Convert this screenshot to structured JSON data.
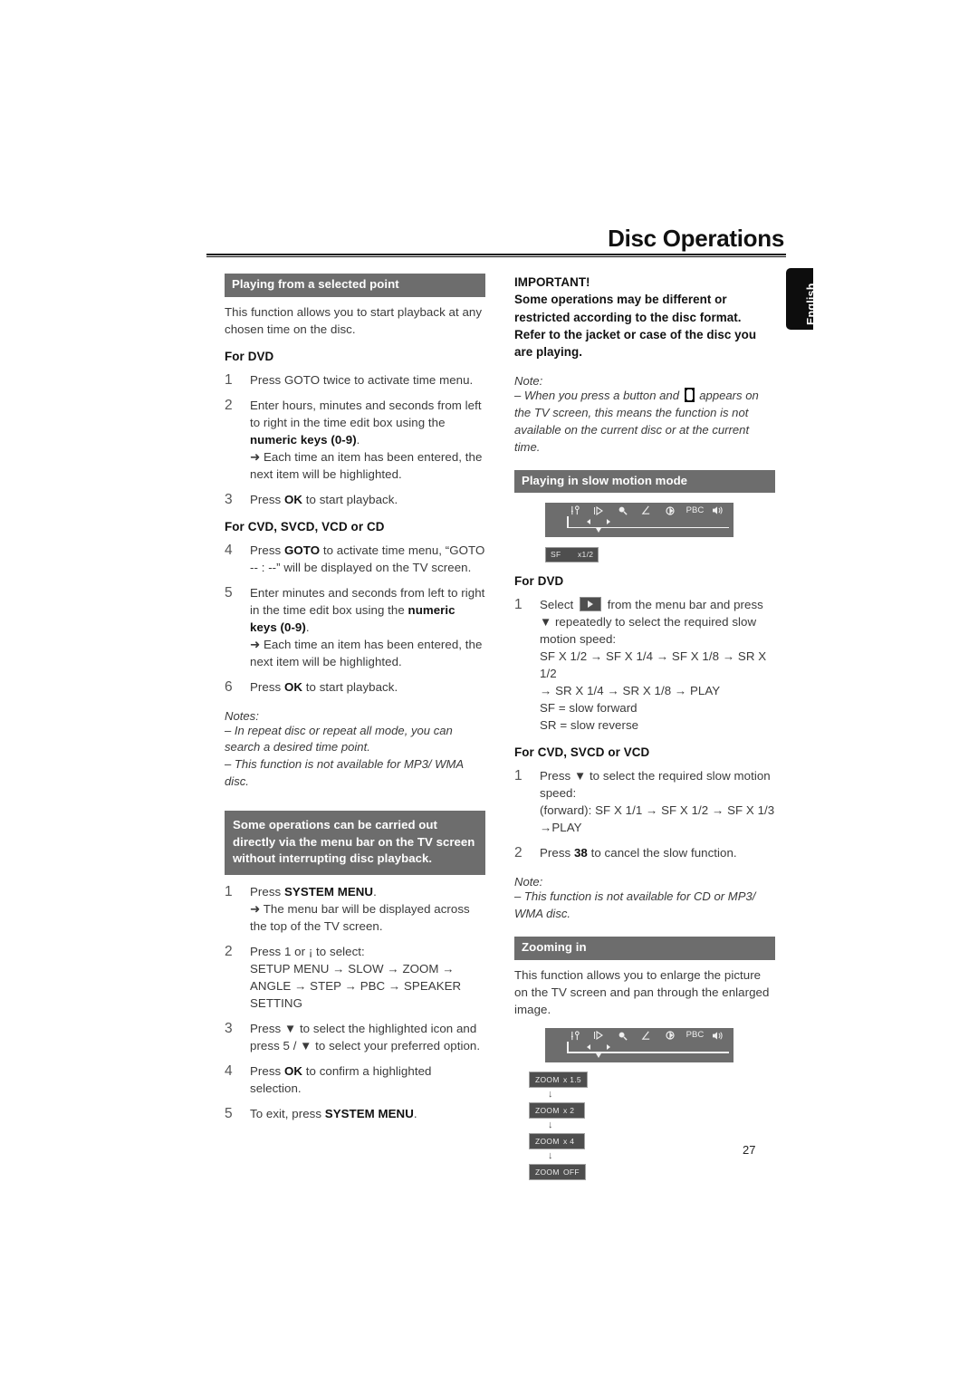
{
  "header": {
    "title": "Disc Operations",
    "language_tab": "English",
    "page_number": "27"
  },
  "left_column": {
    "section1": {
      "bar_title": "Playing from a selected point",
      "intro": "This function allows you to start playback at any chosen time on the disc.",
      "subhead_dvd": "For DVD",
      "steps_dvd": [
        {
          "num": "1",
          "text": "Press GOTO twice to activate time menu."
        },
        {
          "num": "2",
          "text_a": "Enter hours, minutes and seconds from left to right in the time edit box using the ",
          "bold": "numeric keys (0-9)",
          "text_b": ".",
          "arrow": "Each time an item has been entered, the next item will be highlighted."
        },
        {
          "num": "3",
          "text_a": "Press ",
          "bold": "OK",
          "text_b": " to start playback."
        }
      ],
      "subhead_cvd": "For CVD, SVCD, VCD or CD",
      "steps_cvd": [
        {
          "num": "4",
          "text_a": "Press ",
          "bold": "GOTO",
          "text_b": " to activate time menu, “GOTO -- : --” will be displayed on the TV screen."
        },
        {
          "num": "5",
          "text_a": "Enter minutes and seconds from left to right in the time edit box using the ",
          "bold": "numeric keys (0-9)",
          "text_b": ".",
          "arrow": "Each time an item has been entered, the next item will be highlighted."
        },
        {
          "num": "6",
          "text_a": "Press ",
          "bold": "OK",
          "text_b": " to start playback."
        }
      ],
      "notes_head": "Notes:",
      "notes": [
        "–  In repeat disc or repeat all mode, you can search a desired time point.",
        "–  This function is not available for MP3/ WMA disc."
      ]
    },
    "section2": {
      "bar_title": "Some operations can be carried out directly via the menu bar on the TV screen without interrupting disc playback.",
      "steps": [
        {
          "num": "1",
          "text_a": "Press ",
          "bold": "SYSTEM MENU",
          "text_b": ".",
          "arrow": "The menu bar will be displayed across the top of the TV screen."
        },
        {
          "num": "2",
          "text_a": "Press 1    or ¡    to select:",
          "flow": "SETUP MENU → SLOW → ZOOM → ANGLE → STEP → PBC → SPEAKER SETTING"
        },
        {
          "num": "3",
          "text_a": "Press ▼ to select the highlighted icon and press 5  / ▼ to select your preferred option."
        },
        {
          "num": "4",
          "text_a": "Press ",
          "bold": "OK",
          "text_b": " to confirm a highlighted selection."
        },
        {
          "num": "5",
          "text_a": "To exit, press ",
          "bold": "SYSTEM MENU",
          "text_b": "."
        }
      ]
    }
  },
  "right_column": {
    "important": {
      "head": "IMPORTANT!",
      "body": "Some operations may be different or restricted according to the disc format. Refer to the jacket or case of the disc you are playing."
    },
    "note1": {
      "head": "Note:",
      "text_a": "–  When you press a button and ",
      "text_b": " appears on the TV screen, this means the function is not available on the current disc or at the current time."
    },
    "slow_section": {
      "bar_title": "Playing in slow motion mode",
      "osd_chip": {
        "label": "SF",
        "value": "x1/2"
      },
      "menubar_icons": [
        "tools-icon",
        "slow-play-icon",
        "zoom-magnifier-icon",
        "angle-icon",
        "step-icon",
        "pbc-icon",
        "speaker-icon"
      ],
      "subhead_dvd": "For DVD",
      "dvd_step": {
        "num": "1",
        "text_a": "Select ",
        "text_b": " from the menu bar and press ▼ repeatedly to select the required slow motion speed:",
        "flow_line1": "SF X 1/2 → SF X 1/4 → SF X 1/8 → SR X 1/2",
        "flow_line2": "→ SR X 1/4 → SR X 1/8 → PLAY",
        "legend1": "SF = slow forward",
        "legend2": "SR = slow reverse"
      },
      "subhead_cvd": "For CVD, SVCD or VCD",
      "cvd_steps": [
        {
          "num": "1",
          "text": "Press ▼ to select the required slow motion speed:",
          "flow_line1": "(forward): SF X 1/1 → SF X 1/2 → SF X 1/3",
          "flow_line2": "→PLAY"
        },
        {
          "num": "2",
          "text_a": "Press ",
          "bold": "38",
          "text_b": "  to cancel  the slow function."
        }
      ],
      "note_head": "Note:",
      "note_text": "–  This function is not available for CD or MP3/ WMA disc."
    },
    "zoom_section": {
      "bar_title": "Zooming in",
      "intro": "This function allows you to enlarge the picture on the TV screen and pan through the enlarged image.",
      "menubar_icons": [
        "tools-icon",
        "slow-play-icon",
        "zoom-magnifier-icon",
        "angle-icon",
        "step-icon",
        "pbc-icon",
        "speaker-icon"
      ],
      "zoom_steps": [
        {
          "label": "ZOOM",
          "value": "x 1.5"
        },
        {
          "label": "ZOOM",
          "value": "x 2"
        },
        {
          "label": "ZOOM",
          "value": "x 4"
        },
        {
          "label": "ZOOM",
          "value": "OFF"
        }
      ],
      "flow_arrow": "↓"
    }
  },
  "colors": {
    "section_bar": "#6d6d6d",
    "osd_bg": "#4e4e4e",
    "tab_bg": "#0d0d0d",
    "text": "#3a3a3a"
  }
}
